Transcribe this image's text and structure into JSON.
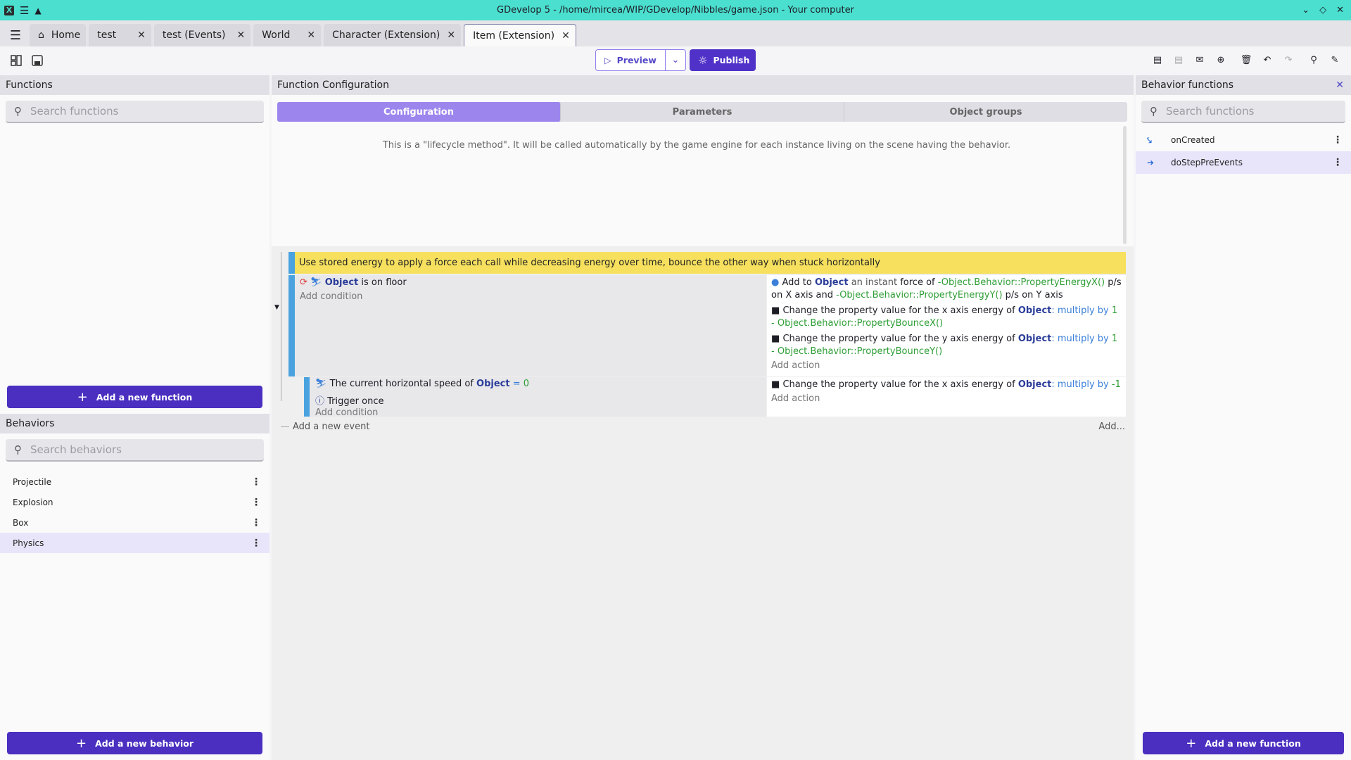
{
  "window": {
    "title": "GDevelop 5 - /home/mircea/WIP/GDevelop/Nibbles/game.json - Your computer"
  },
  "tabs": [
    {
      "label": "Home"
    },
    {
      "label": "test"
    },
    {
      "label": "test (Events)"
    },
    {
      "label": "World"
    },
    {
      "label": "Character (Extension)"
    },
    {
      "label": "Item (Extension)"
    }
  ],
  "toolbar": {
    "preview_label": "Preview",
    "publish_label": "Publish"
  },
  "functions_panel": {
    "title": "Functions",
    "search_placeholder": "Search functions",
    "add_button": "Add a new function"
  },
  "behaviors_panel": {
    "title": "Behaviors",
    "search_placeholder": "Search behaviors",
    "items": [
      {
        "label": "Projectile"
      },
      {
        "label": "Explosion"
      },
      {
        "label": "Box"
      },
      {
        "label": "Physics"
      }
    ],
    "add_button": "Add a new behavior"
  },
  "function_config": {
    "title": "Function Configuration",
    "tabs": [
      {
        "label": "Configuration"
      },
      {
        "label": "Parameters"
      },
      {
        "label": "Object groups"
      }
    ],
    "lifecycle_text": "This is a \"lifecycle method\". It will be called automatically by the game engine for each instance living on the scene having the behavior."
  },
  "events": {
    "comment": "Use stored energy to apply a force each call while decreasing energy over time, bounce the other way when stuck horizontally",
    "event1": {
      "cond_object": "Object",
      "cond_text": "is on floor",
      "add_condition": "Add condition",
      "a1_pre": "Add to",
      "a1_obj": "Object",
      "a1_mid": "an instant",
      "a1_force": "force of",
      "a1_x": "-Object.Behavior::PropertyEnergyX()",
      "a1_ps1": "p/s on X axis and",
      "a1_y": "-Object.Behavior::PropertyEnergyY()",
      "a1_ps2": "p/s on Y axis",
      "a2_text": "Change the property value for the x axis energy of",
      "a2_obj": "Object",
      "a2_op": ": multiply by",
      "a2_val": "1 -",
      "a2_expr": "Object.Behavior::PropertyBounceX()",
      "a3_text": "Change the property value for the y axis energy of",
      "a3_obj": "Object",
      "a3_op": ": multiply by",
      "a3_val": "1 -",
      "a3_expr": "Object.Behavior::PropertyBounceY()",
      "add_action": "Add action"
    },
    "event2": {
      "cond_text": "The current horizontal speed of",
      "cond_object": "Object",
      "cond_op": "=",
      "cond_val": "0",
      "trigger": "Trigger once",
      "add_condition": "Add condition",
      "a_text": "Change the property value for the x axis energy of",
      "a_obj": "Object",
      "a_op": ": multiply by",
      "a_val": "-1",
      "add_action": "Add action"
    },
    "add_event": "Add a new event",
    "add_more": "Add..."
  },
  "behavior_functions": {
    "title": "Behavior functions",
    "search_placeholder": "Search functions",
    "items": [
      {
        "label": "onCreated",
        "icon": "lifecycle-created-icon"
      },
      {
        "label": "doStepPreEvents",
        "icon": "lifecycle-step-icon"
      }
    ],
    "add_button": "Add a new function"
  },
  "colors": {
    "accent": "#4a2fc0",
    "titlebar": "#4bdfcf",
    "comment": "#f6e05e",
    "event_bar": "#4aa3df"
  }
}
